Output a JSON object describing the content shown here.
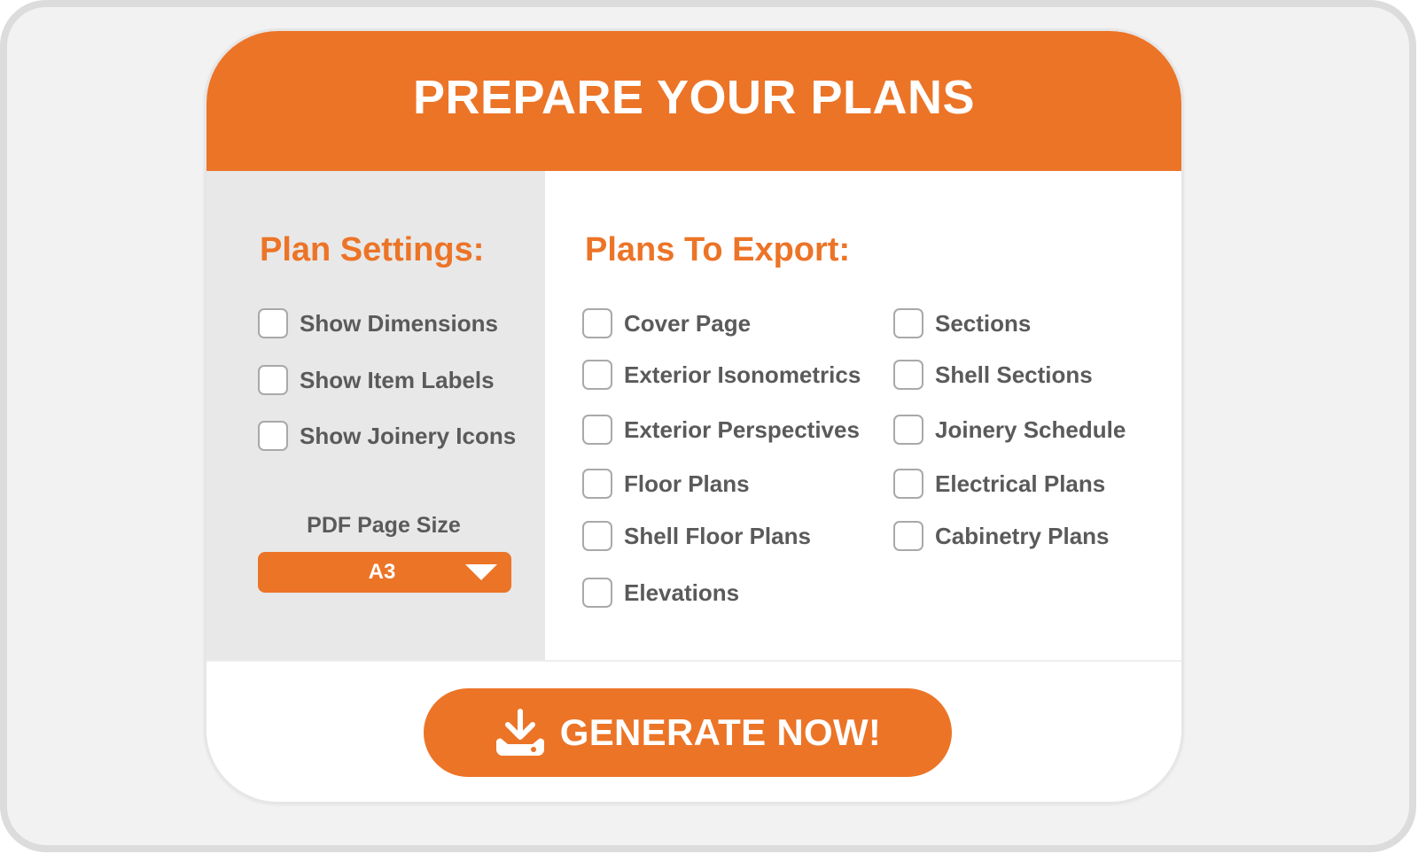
{
  "header": {
    "title": "PREPARE YOUR PLANS"
  },
  "plan_settings": {
    "title": "Plan Settings:",
    "options": [
      {
        "label": "Show Dimensions",
        "checked": false
      },
      {
        "label": "Show Item Labels",
        "checked": false
      },
      {
        "label": "Show Joinery Icons",
        "checked": false
      }
    ],
    "page_size_label": "PDF Page Size",
    "page_size_value": "A3"
  },
  "plans_to_export": {
    "title": "Plans To Export:",
    "col1": [
      {
        "label": "Cover Page",
        "checked": false
      },
      {
        "label": "Exterior Isonometrics",
        "checked": false
      },
      {
        "label": "Exterior Perspectives",
        "checked": false
      },
      {
        "label": "Floor Plans",
        "checked": false
      },
      {
        "label": "Shell Floor Plans",
        "checked": false
      },
      {
        "label": "Elevations",
        "checked": false
      }
    ],
    "col2": [
      {
        "label": "Sections",
        "checked": false
      },
      {
        "label": "Shell Sections",
        "checked": false
      },
      {
        "label": "Joinery Schedule",
        "checked": false
      },
      {
        "label": "Electrical Plans",
        "checked": false
      },
      {
        "label": "Cabinetry Plans",
        "checked": false
      }
    ]
  },
  "generate": {
    "label": "GENERATE NOW!",
    "icon": "download-icon"
  },
  "colors": {
    "accent": "#ec7427",
    "panel": "#e8e8e8",
    "text": "#5a5a5a"
  }
}
